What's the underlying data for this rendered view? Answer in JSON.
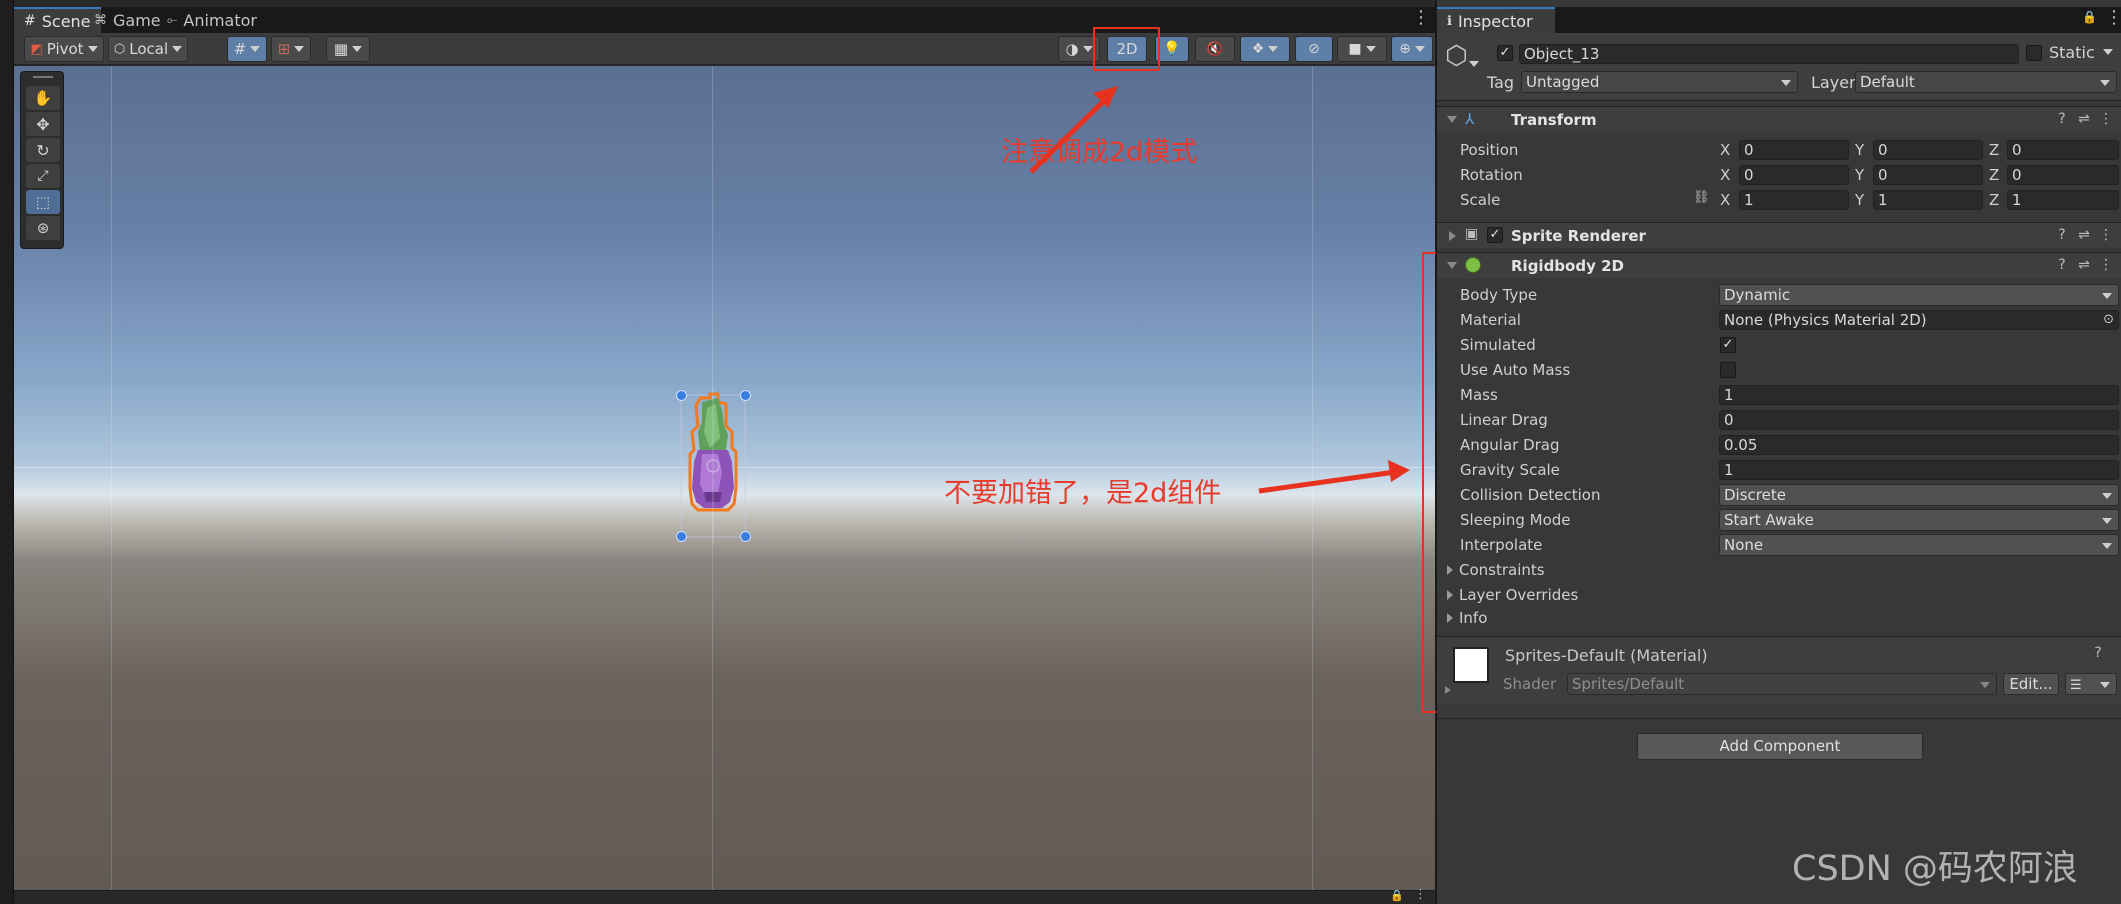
{
  "scene_window": {
    "tabs": [
      {
        "label": "Scene",
        "icon": "scene-grid-icon",
        "active": true
      },
      {
        "label": "Game",
        "icon": "gamepad-icon",
        "active": false
      },
      {
        "label": "Animator",
        "icon": "animator-icon",
        "active": false
      }
    ],
    "toolbar": {
      "pivot_label": "Pivot",
      "local_label": "Local",
      "mode_2d_label": "2D"
    },
    "tools": [
      "hand-tool",
      "move-tool",
      "rotate-tool",
      "scale-tool",
      "rect-tool",
      "transform-tool"
    ]
  },
  "annotations": {
    "mode_note": "注意调成2d模式",
    "component_note": "不要加错了，是2d组件",
    "color": "#e6321f"
  },
  "inspector": {
    "tab_label": "Inspector",
    "object": {
      "name": "Object_13",
      "active": true,
      "static_label": "Static",
      "tag_label": "Tag",
      "tag_value": "Untagged",
      "layer_label": "Layer",
      "layer_value": "Default"
    },
    "transform": {
      "title": "Transform",
      "rows": [
        {
          "label": "Position",
          "x": "0",
          "y": "0",
          "z": "0"
        },
        {
          "label": "Rotation",
          "x": "0",
          "y": "0",
          "z": "0"
        },
        {
          "label": "Scale",
          "x": "1",
          "y": "1",
          "z": "1"
        }
      ],
      "axis_x": "X",
      "axis_y": "Y",
      "axis_z": "Z"
    },
    "sprite_renderer": {
      "title": "Sprite Renderer",
      "enabled": true
    },
    "rigidbody2d": {
      "title_main": "Rigidbody",
      "title_suffix": "2D",
      "body_type_label": "Body Type",
      "body_type": "Dynamic",
      "material_label": "Material",
      "material": "None (Physics Material 2D)",
      "simulated_label": "Simulated",
      "simulated": true,
      "use_auto_mass_label": "Use Auto Mass",
      "use_auto_mass": false,
      "mass_label": "Mass",
      "mass": "1",
      "linear_drag_label": "Linear Drag",
      "linear_drag": "0",
      "angular_drag_label": "Angular Drag",
      "angular_drag": "0.05",
      "gravity_scale_label": "Gravity Scale",
      "gravity_scale": "1",
      "collision_detection_label": "Collision Detection",
      "collision_detection": "Discrete",
      "sleeping_mode_label": "Sleeping Mode",
      "sleeping_mode": "Start Awake",
      "interpolate_label": "Interpolate",
      "interpolate": "None",
      "foldouts": [
        "Constraints",
        "Layer Overrides",
        "Info"
      ]
    },
    "material": {
      "name": "Sprites-Default (Material)",
      "shader_label": "Shader",
      "shader_value": "Sprites/Default",
      "edit_label": "Edit..."
    },
    "add_component_label": "Add Component"
  },
  "watermark": "CSDN @码农阿浪"
}
